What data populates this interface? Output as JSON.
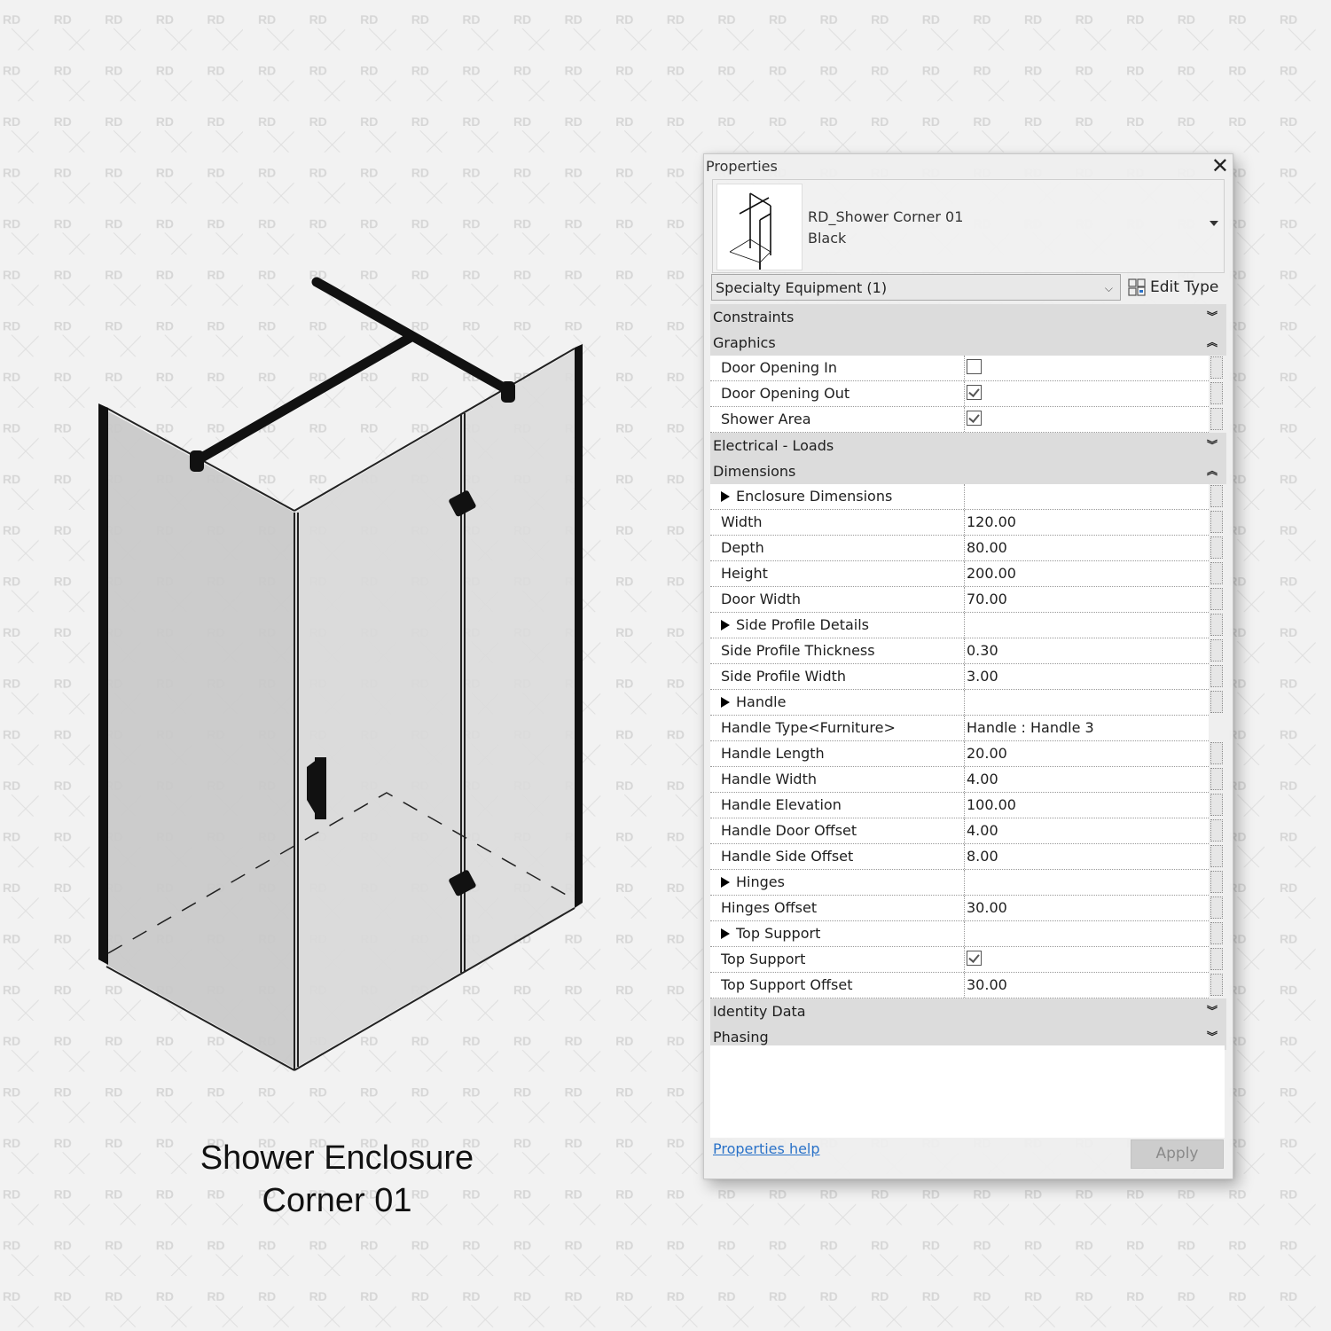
{
  "background": {
    "watermark_text": "RD",
    "color": "#f2f2f2"
  },
  "illustration": {
    "title_line1": "Shower Enclosure",
    "title_line2": "Corner 01",
    "frame_color": "#111111",
    "glass_color": "#cfcfcf"
  },
  "properties": {
    "title": "Properties",
    "close_label": "✕",
    "type": {
      "name_line1": "RD_Shower Corner 01",
      "name_line2": "Black"
    },
    "category_selector": {
      "value": "Specialty Equipment (1)",
      "chevron": "⌵"
    },
    "edit_type_label": "Edit Type",
    "groups": [
      {
        "name": "Constraints",
        "state": "collapsed",
        "toggle": "︾",
        "rows": []
      },
      {
        "name": "Graphics",
        "state": "expanded",
        "toggle": "︽",
        "rows": [
          {
            "label": "Door Opening In",
            "kind": "checkbox",
            "checked": false
          },
          {
            "label": "Door Opening Out",
            "kind": "checkbox",
            "checked": true
          },
          {
            "label": "Shower Area",
            "kind": "checkbox",
            "checked": true
          }
        ]
      },
      {
        "name": "Electrical - Loads",
        "state": "collapsed",
        "toggle": "︾",
        "rows": []
      },
      {
        "name": "Dimensions",
        "state": "expanded",
        "toggle": "︽",
        "rows": [
          {
            "label": "Enclosure Dimensions",
            "kind": "subheader",
            "value": ""
          },
          {
            "label": "Width",
            "kind": "text",
            "value": "120.00"
          },
          {
            "label": "Depth",
            "kind": "text",
            "value": "80.00"
          },
          {
            "label": "Height",
            "kind": "text",
            "value": "200.00"
          },
          {
            "label": "Door Width",
            "kind": "text",
            "value": "70.00"
          },
          {
            "label": "Side Profile Details",
            "kind": "subheader",
            "value": ""
          },
          {
            "label": "Side Profile Thickness",
            "kind": "text",
            "value": "0.30"
          },
          {
            "label": "Side Profile Width",
            "kind": "text",
            "value": "3.00"
          },
          {
            "label": "Handle",
            "kind": "subheader",
            "value": ""
          },
          {
            "label": "Handle Type<Furniture>",
            "kind": "text",
            "value": "Handle : Handle 3",
            "no_button": true
          },
          {
            "label": "Handle Length",
            "kind": "text",
            "value": "20.00"
          },
          {
            "label": "Handle Width",
            "kind": "text",
            "value": "4.00"
          },
          {
            "label": "Handle Elevation",
            "kind": "text",
            "value": "100.00"
          },
          {
            "label": "Handle Door Offset",
            "kind": "text",
            "value": "4.00"
          },
          {
            "label": "Handle Side Offset",
            "kind": "text",
            "value": "8.00"
          },
          {
            "label": "Hinges",
            "kind": "subheader",
            "value": ""
          },
          {
            "label": "Hinges Offset",
            "kind": "text",
            "value": "30.00"
          },
          {
            "label": "Top Support",
            "kind": "subheader",
            "value": ""
          },
          {
            "label": "Top Support",
            "kind": "checkbox",
            "checked": true
          },
          {
            "label": "Top Support Offset",
            "kind": "text",
            "value": "30.00"
          }
        ]
      },
      {
        "name": "Identity Data",
        "state": "collapsed",
        "toggle": "︾",
        "rows": []
      },
      {
        "name": "Phasing",
        "state": "collapsed",
        "toggle": "︾",
        "rows": []
      }
    ],
    "help_link": "Properties help",
    "apply_label": "Apply"
  }
}
